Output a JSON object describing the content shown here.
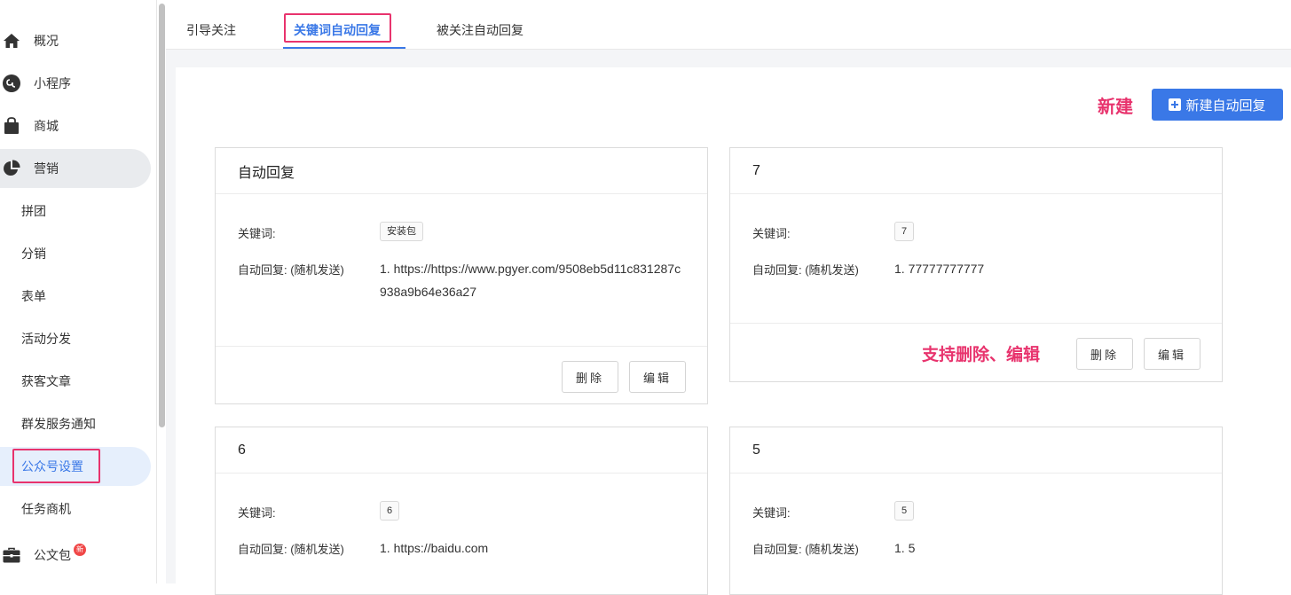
{
  "sidebar": {
    "items": [
      {
        "label": "概况",
        "icon": "home-icon"
      },
      {
        "label": "小程序",
        "icon": "mini-program-icon"
      },
      {
        "label": "商城",
        "icon": "shopping-bag-icon"
      },
      {
        "label": "营销",
        "icon": "pie-chart-icon"
      },
      {
        "label": "拼团"
      },
      {
        "label": "分销"
      },
      {
        "label": "表单"
      },
      {
        "label": "活动分发"
      },
      {
        "label": "获客文章"
      },
      {
        "label": "群发服务通知"
      },
      {
        "label": "公众号设置"
      },
      {
        "label": "任务商机"
      },
      {
        "label": "公文包",
        "icon": "briefcase-icon",
        "badge": "新"
      }
    ]
  },
  "tabs": [
    {
      "label": "引导关注"
    },
    {
      "label": "关键词自动回复"
    },
    {
      "label": "被关注自动回复"
    }
  ],
  "annotations": {
    "new_label": "新建",
    "edit_delete_label": "支持删除、编辑"
  },
  "toolbar": {
    "new_button_label": "新建自动回复"
  },
  "labels": {
    "keyword": "关键词:",
    "auto_reply": "自动回复: (随机发送)",
    "delete": "删除",
    "edit": "编辑"
  },
  "cards": [
    {
      "title": "自动回复",
      "keyword": "安装包",
      "reply": "1. https://https://www.pgyer.com/9508eb5d11c831287c938a9b64e36a27"
    },
    {
      "title": "7",
      "keyword": "7",
      "reply": "1. 77777777777"
    },
    {
      "title": "6",
      "keyword": "6",
      "reply": "1. https://baidu.com"
    },
    {
      "title": "5",
      "keyword": "5",
      "reply": "1. 5"
    }
  ],
  "colors": {
    "accent": "#3a78e7",
    "highlight": "#e8336d",
    "badge": "#f04848"
  }
}
